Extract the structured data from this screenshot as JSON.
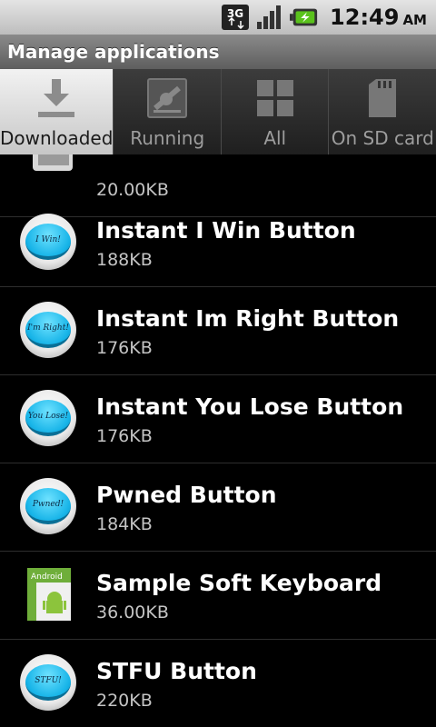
{
  "status_bar": {
    "network_label": "3G",
    "time": "12:49",
    "ampm": "AM",
    "icons": [
      "network-3g-icon",
      "signal-strength-icon",
      "battery-charging-icon"
    ]
  },
  "title": "Manage applications",
  "tabs": [
    {
      "label": "Downloaded",
      "icon": "download-icon",
      "active": true
    },
    {
      "label": "Running",
      "icon": "running-icon",
      "active": false
    },
    {
      "label": "All",
      "icon": "grid-icon",
      "active": false
    },
    {
      "label": "On SD card",
      "icon": "sd-card-icon",
      "active": false
    }
  ],
  "apps": [
    {
      "name": "",
      "size": "20.00KB",
      "icon": "app-icon"
    },
    {
      "name": "Instant I Win Button",
      "size": "188KB",
      "icon_text": "I Win!"
    },
    {
      "name": "Instant Im Right Button",
      "size": "176KB",
      "icon_text": "I'm Right!"
    },
    {
      "name": "Instant You Lose Button",
      "size": "176KB",
      "icon_text": "You Lose!"
    },
    {
      "name": "Pwned Button",
      "size": "184KB",
      "icon_text": "Pwned!"
    },
    {
      "name": "Sample Soft Keyboard",
      "size": "36.00KB",
      "icon_text": "Android"
    },
    {
      "name": "STFU Button",
      "size": "220KB",
      "icon_text": "STFU!"
    }
  ],
  "colors": {
    "accent_button": "#17b4e8",
    "active_tab": "#e8e8e8"
  }
}
